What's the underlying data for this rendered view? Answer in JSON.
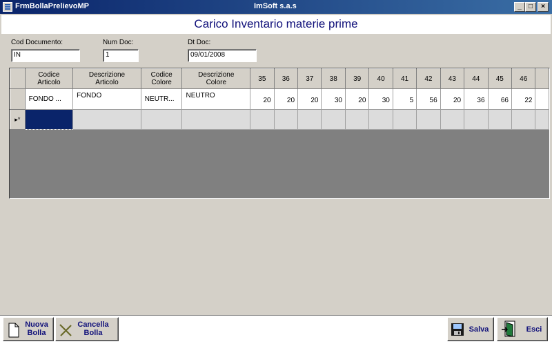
{
  "window": {
    "title": "FrmBollaPrelievoMP",
    "company": "ImSoft s.a.s",
    "minimize": "_",
    "maximize": "□",
    "close": "×"
  },
  "header": {
    "title": "Carico Inventario materie prime"
  },
  "fields": {
    "cod_documento": {
      "label": "Cod Documento:",
      "value": "IN"
    },
    "num_doc": {
      "label": "Num Doc:",
      "value": "1"
    },
    "dt_doc": {
      "label": "Dt Doc:",
      "value": "09/01/2008"
    }
  },
  "grid": {
    "headers": {
      "codice_articolo": [
        "Codice",
        "Articolo"
      ],
      "descrizione_articolo": [
        "Descrizione",
        "Articolo"
      ],
      "codice_colore": [
        "Codice",
        "Colore"
      ],
      "descrizione_colore": [
        "Descrizione",
        "Colore"
      ],
      "sizes": [
        "35",
        "36",
        "37",
        "38",
        "39",
        "40",
        "41",
        "42",
        "43",
        "44",
        "45",
        "46"
      ]
    },
    "row": {
      "codice_articolo": "FONDO ...",
      "descrizione_articolo": "FONDO",
      "codice_colore": "NEUTR...",
      "descrizione_colore": "NEUTRO",
      "quantities": [
        "20",
        "20",
        "20",
        "30",
        "20",
        "30",
        "5",
        "56",
        "20",
        "36",
        "66",
        "22"
      ]
    },
    "new_row_marker": "▸*"
  },
  "toolbar": {
    "nuova_bolla": [
      "Nuova",
      "Bolla"
    ],
    "cancella_bolla": [
      "Cancella",
      "Bolla"
    ],
    "salva": "Salva",
    "esci": "Esci"
  },
  "icons": {
    "app": "app-icon",
    "nuova_bolla": "blank-page-icon",
    "cancella_bolla": "cross-icon",
    "salva": "floppy-disk-icon",
    "esci": "exit-door-icon"
  }
}
